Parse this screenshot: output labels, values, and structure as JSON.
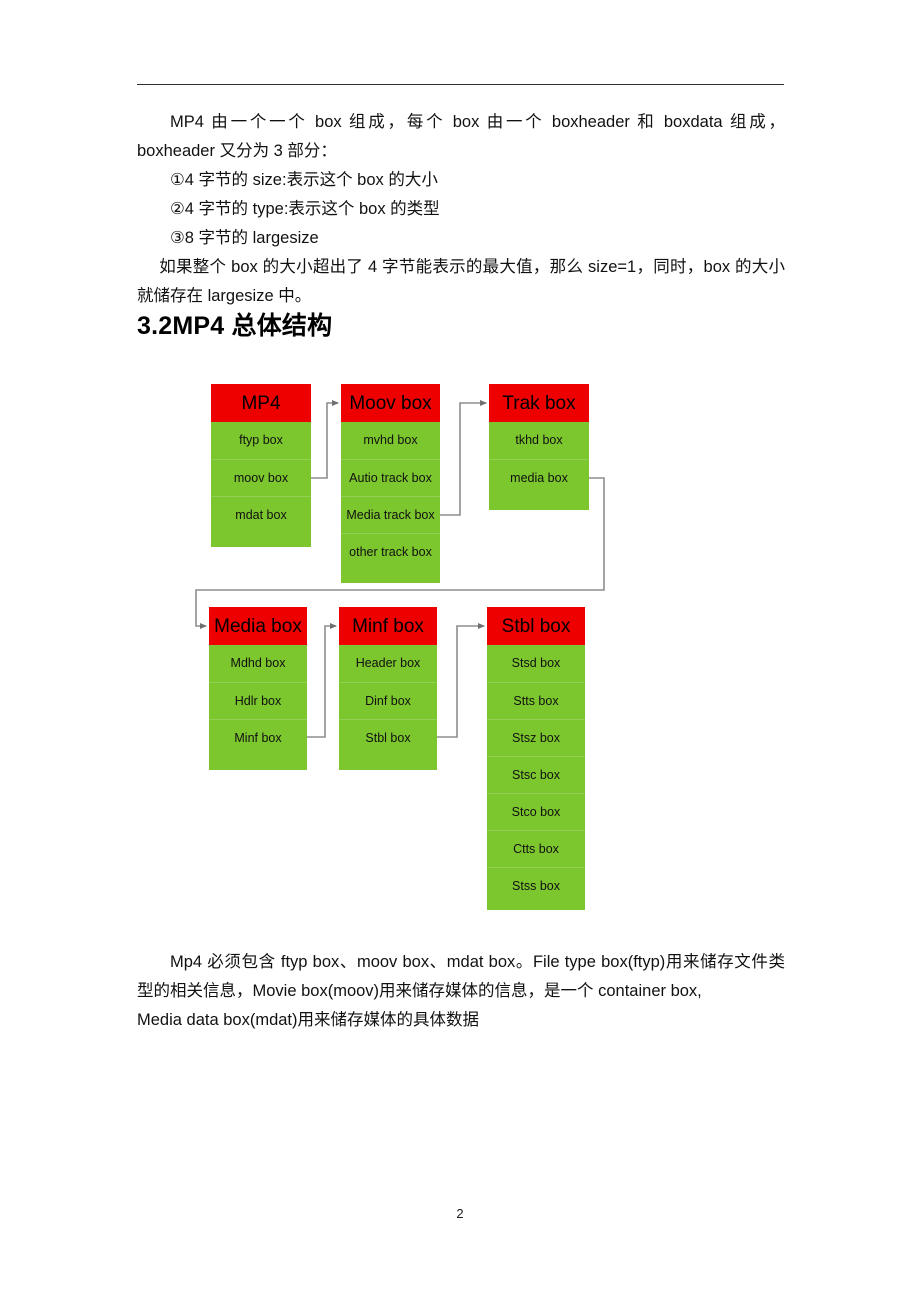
{
  "page": {
    "number": "2"
  },
  "intro": {
    "line1": "MP4 由一个一个 box 组成，每个 box 由一个 boxheader 和 boxdata 组成，boxheader 又分为 3 部分：",
    "line2": "①4 字节的 size:表示这个 box 的大小",
    "line3": "②4 字节的 type:表示这个 box 的类型",
    "line4": "③8 字节的 largesize",
    "line5": "如果整个 box 的大小超出了 4 字节能表示的最大值，那么 size=1，同时，box 的大小就储存在 largesize 中。"
  },
  "heading": {
    "section": "3.2MP4 总体结构"
  },
  "closing": {
    "line1": "Mp4 必须包含 ftyp box、moov box、mdat box。File type box(ftyp)用来储存文件类型的相关信息，Movie box(moov)用来储存媒体的信息，是一个 container box,",
    "line2": "Media data box(mdat)用来储存媒体的具体数据"
  },
  "diagram": {
    "colors": {
      "header_fill": "#EE0000",
      "body_fill": "#7CC62E",
      "connector": "#808080",
      "text": "#000000"
    },
    "groups": [
      {
        "id": "mp4",
        "title": "MP4",
        "rows": [
          "ftyp box",
          "moov box",
          "mdat box"
        ]
      },
      {
        "id": "moov",
        "title": "Moov box",
        "rows": [
          "mvhd box",
          "Autio track box",
          "Media track box",
          "other track box"
        ]
      },
      {
        "id": "trak",
        "title": "Trak box",
        "rows": [
          "tkhd box",
          "media box"
        ]
      },
      {
        "id": "media",
        "title": "Media box",
        "rows": [
          "Mdhd box",
          "Hdlr box",
          "Minf box"
        ]
      },
      {
        "id": "minf",
        "title": "Minf box",
        "rows": [
          "Header box",
          "Dinf box",
          "Stbl box"
        ]
      },
      {
        "id": "stbl",
        "title": "Stbl box",
        "rows": [
          "Stsd box",
          "Stts box",
          "Stsz box",
          "Stsc box",
          "Stco box",
          "Ctts box",
          "Stss box"
        ]
      }
    ],
    "connections": [
      {
        "from": "mp4.moov box",
        "to": "moov.header"
      },
      {
        "from": "moov.Media track box",
        "to": "trak.header"
      },
      {
        "from": "trak.media box",
        "to": "media.header"
      },
      {
        "from": "media.Minf box",
        "to": "minf.header"
      },
      {
        "from": "minf.Stbl box",
        "to": "stbl.header"
      }
    ]
  }
}
